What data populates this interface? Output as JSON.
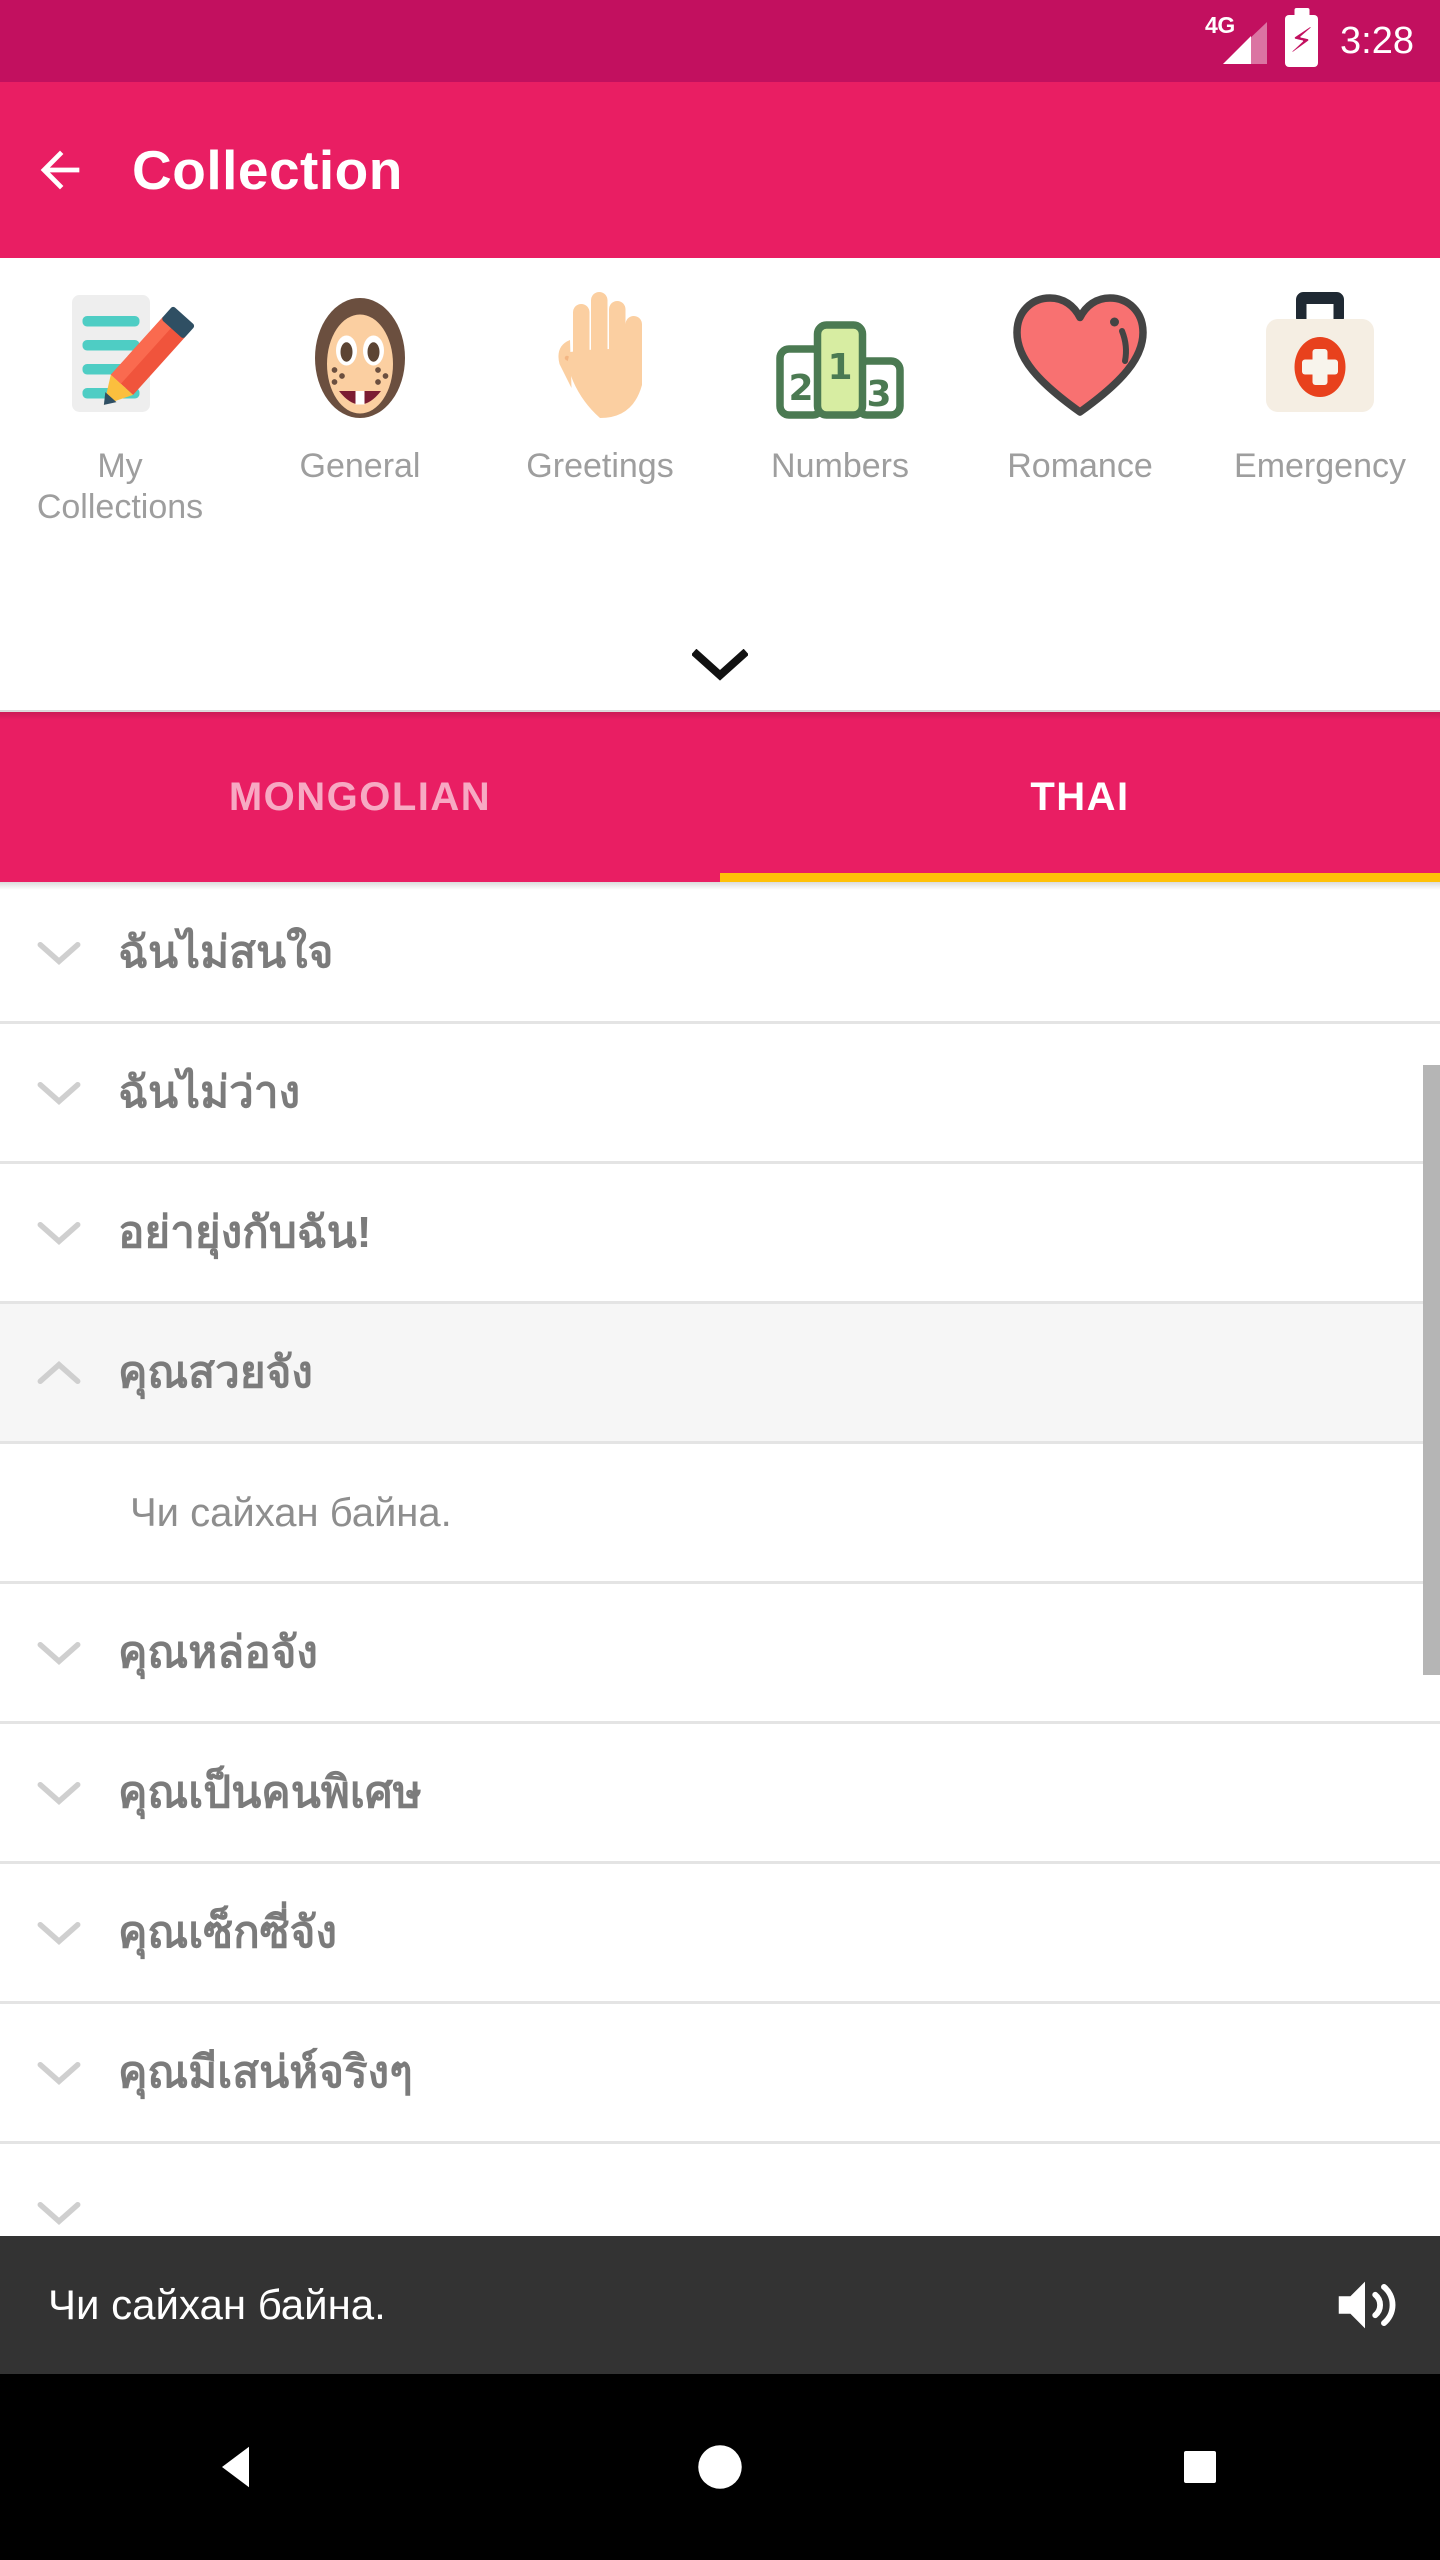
{
  "status_bar": {
    "network_label": "4G",
    "time": "3:28",
    "battery_state": "charging",
    "background_color": "#c2105f"
  },
  "app_bar": {
    "title": "Collection",
    "back_label": "Back",
    "background_color": "#e91e63"
  },
  "categories": {
    "expand_label": "Show more categories",
    "items": [
      {
        "label": "My Collections",
        "icon": "notepad-pencil-icon"
      },
      {
        "label": "General",
        "icon": "girl-face-icon"
      },
      {
        "label": "Greetings",
        "icon": "waving-hand-icon"
      },
      {
        "label": "Numbers",
        "icon": "podium-icon"
      },
      {
        "label": "Romance",
        "icon": "heart-icon"
      },
      {
        "label": "Emergency",
        "icon": "first-aid-kit-icon"
      }
    ]
  },
  "tabs": {
    "active_index": 1,
    "indicator_color": "#ffc107",
    "items": [
      {
        "label": "MONGOLIAN"
      },
      {
        "label": "THAI"
      }
    ]
  },
  "phrase_list": {
    "rows": [
      {
        "text": "ฉันไม่สนใจ",
        "expanded": false,
        "translation": ""
      },
      {
        "text": "ฉันไม่ว่าง",
        "expanded": false,
        "translation": ""
      },
      {
        "text": "อย่ายุ่งกับฉัน!",
        "expanded": false,
        "translation": ""
      },
      {
        "text": "คุณสวยจัง",
        "expanded": true,
        "translation": "Чи сайхан байна."
      },
      {
        "text": "คุณหล่อจัง",
        "expanded": false,
        "translation": ""
      },
      {
        "text": "คุณเป็นคนพิเศษ",
        "expanded": false,
        "translation": ""
      },
      {
        "text": "คุณเซ็กซี่จัง",
        "expanded": false,
        "translation": ""
      },
      {
        "text": "คุณมีเสน่ห์จริงๆ",
        "expanded": false,
        "translation": ""
      }
    ]
  },
  "player_bar": {
    "text": "Чи сайхан байна.",
    "speaker_label": "Play audio",
    "background_color": "#333333"
  },
  "nav_bar": {
    "back_label": "Back",
    "home_label": "Home",
    "recents_label": "Recents"
  }
}
